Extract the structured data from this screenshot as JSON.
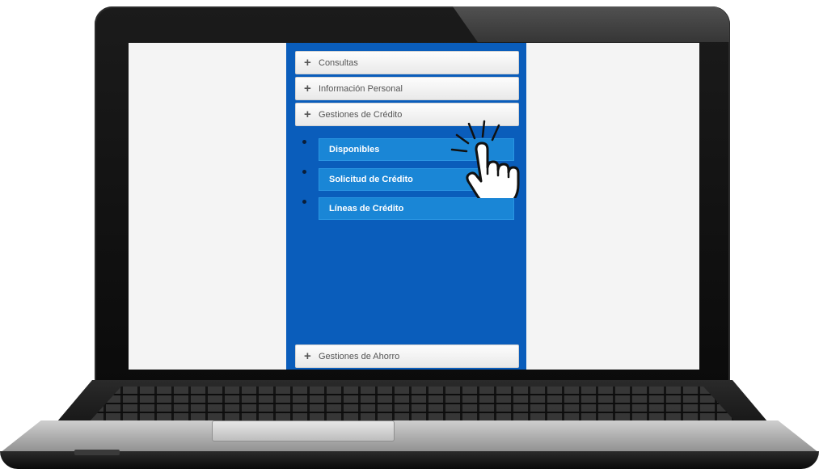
{
  "menu": {
    "items": [
      {
        "label": "Consultas",
        "icon": "plus-icon"
      },
      {
        "label": "Información Personal",
        "icon": "plus-icon"
      },
      {
        "label": "Gestiones de Crédito",
        "icon": "plus-icon"
      }
    ],
    "submenu": [
      {
        "label": "Disponibles"
      },
      {
        "label": "Solicitud de Crédito"
      },
      {
        "label": "Líneas de Crédito"
      }
    ],
    "bottom_item": {
      "label": "Gestiones de Ahorro",
      "icon": "plus-icon"
    },
    "plus_glyph": "+"
  },
  "colors": {
    "panel": "#0a5dbb",
    "submenu_item": "#1a86d6",
    "menu_item": "#eeeeee"
  },
  "cursor": {
    "icon": "hand-pointer-icon"
  }
}
